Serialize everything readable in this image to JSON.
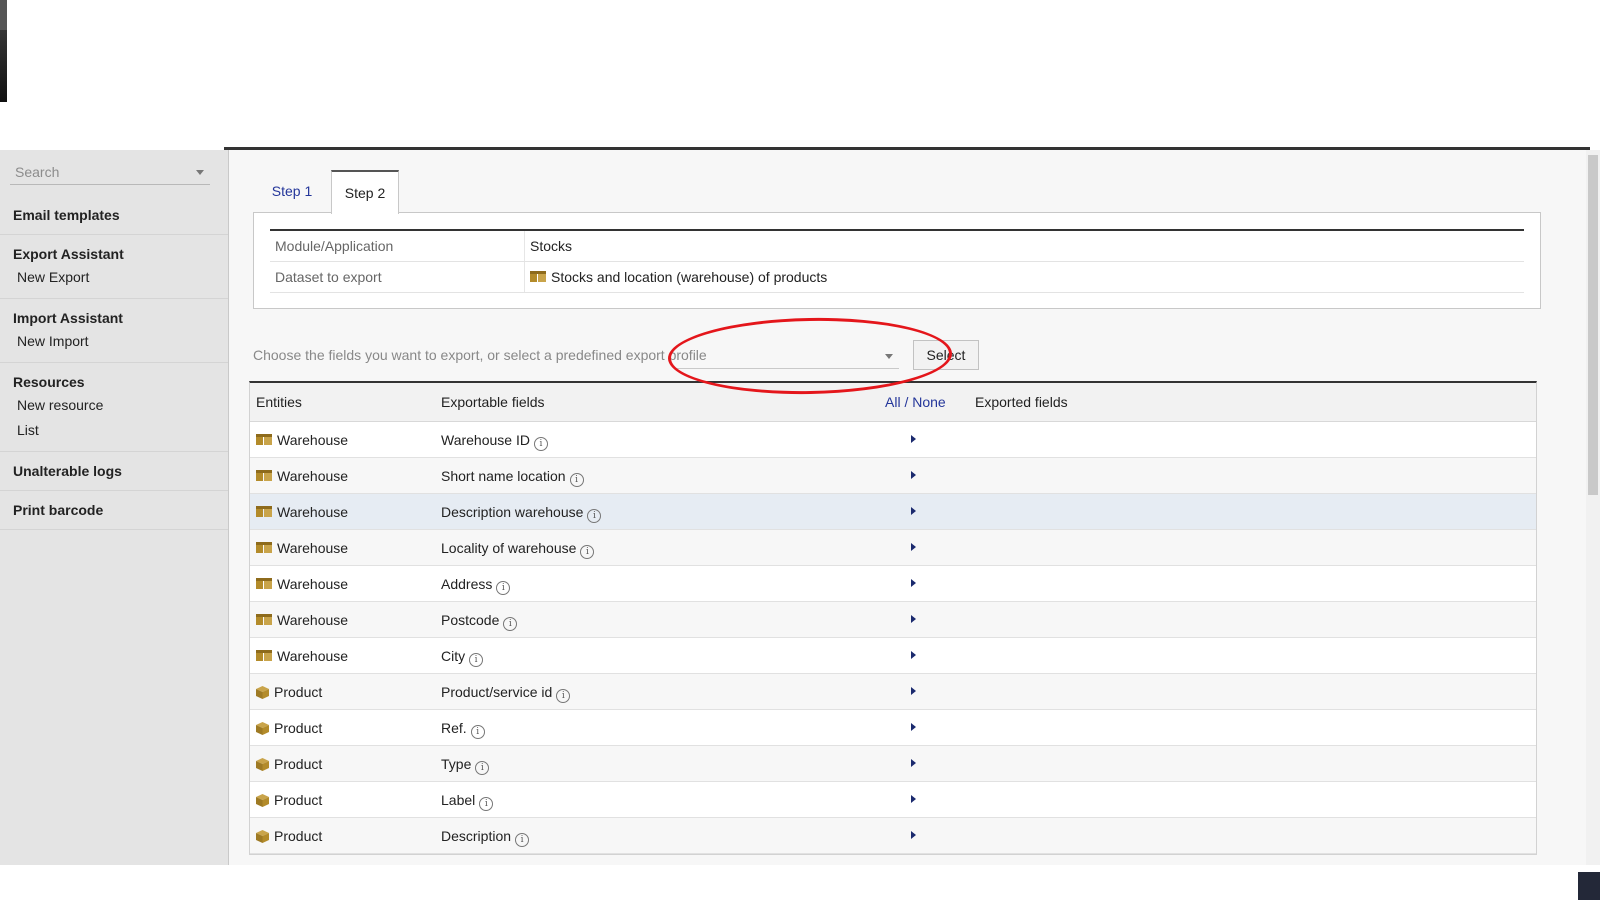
{
  "sidebar": {
    "search_placeholder": "Search",
    "sections": [
      {
        "title": "Email templates",
        "items": []
      },
      {
        "title": "Export Assistant",
        "items": [
          "New Export"
        ]
      },
      {
        "title": "Import Assistant",
        "items": [
          "New Import"
        ]
      },
      {
        "title": "Resources",
        "items": [
          "New resource",
          "List"
        ]
      },
      {
        "title": "Unalterable logs",
        "items": []
      },
      {
        "title": "Print barcode",
        "items": []
      }
    ]
  },
  "tabs": {
    "step1": "Step 1",
    "step2": "Step 2",
    "active": "Step 2"
  },
  "info": {
    "module_label": "Module/Application",
    "module_value": "Stocks",
    "dataset_label": "Dataset to export",
    "dataset_value": "Stocks and location (warehouse) of products"
  },
  "profile": {
    "prompt": "Choose the fields you want to export, or select a predefined export profile",
    "selected_value": "",
    "button_label": "Select"
  },
  "annotation": {
    "color": "#e4161b",
    "shape": "ellipse"
  },
  "fields_table": {
    "headers": {
      "entities": "Entities",
      "exportable": "Exportable fields",
      "all_none": "All / None",
      "exported": "Exported fields"
    },
    "rows": [
      {
        "entity": "Warehouse",
        "field": "Warehouse ID"
      },
      {
        "entity": "Warehouse",
        "field": "Short name location"
      },
      {
        "entity": "Warehouse",
        "field": "Description warehouse"
      },
      {
        "entity": "Warehouse",
        "field": "Locality of warehouse"
      },
      {
        "entity": "Warehouse",
        "field": "Address"
      },
      {
        "entity": "Warehouse",
        "field": "Postcode"
      },
      {
        "entity": "Warehouse",
        "field": "City"
      },
      {
        "entity": "Product",
        "field": "Product/service id"
      },
      {
        "entity": "Product",
        "field": "Ref."
      },
      {
        "entity": "Product",
        "field": "Type"
      },
      {
        "entity": "Product",
        "field": "Label"
      },
      {
        "entity": "Product",
        "field": "Description"
      }
    ],
    "highlighted_row": 3
  },
  "colors": {
    "link": "#24369a",
    "icon_gold": "#b38b2a",
    "highlight_row": "#e6ecf3"
  },
  "icons": {
    "warehouse": "boxes-icon",
    "product": "product-box-icon",
    "info": "info-icon",
    "move": "arrow-right-icon"
  }
}
